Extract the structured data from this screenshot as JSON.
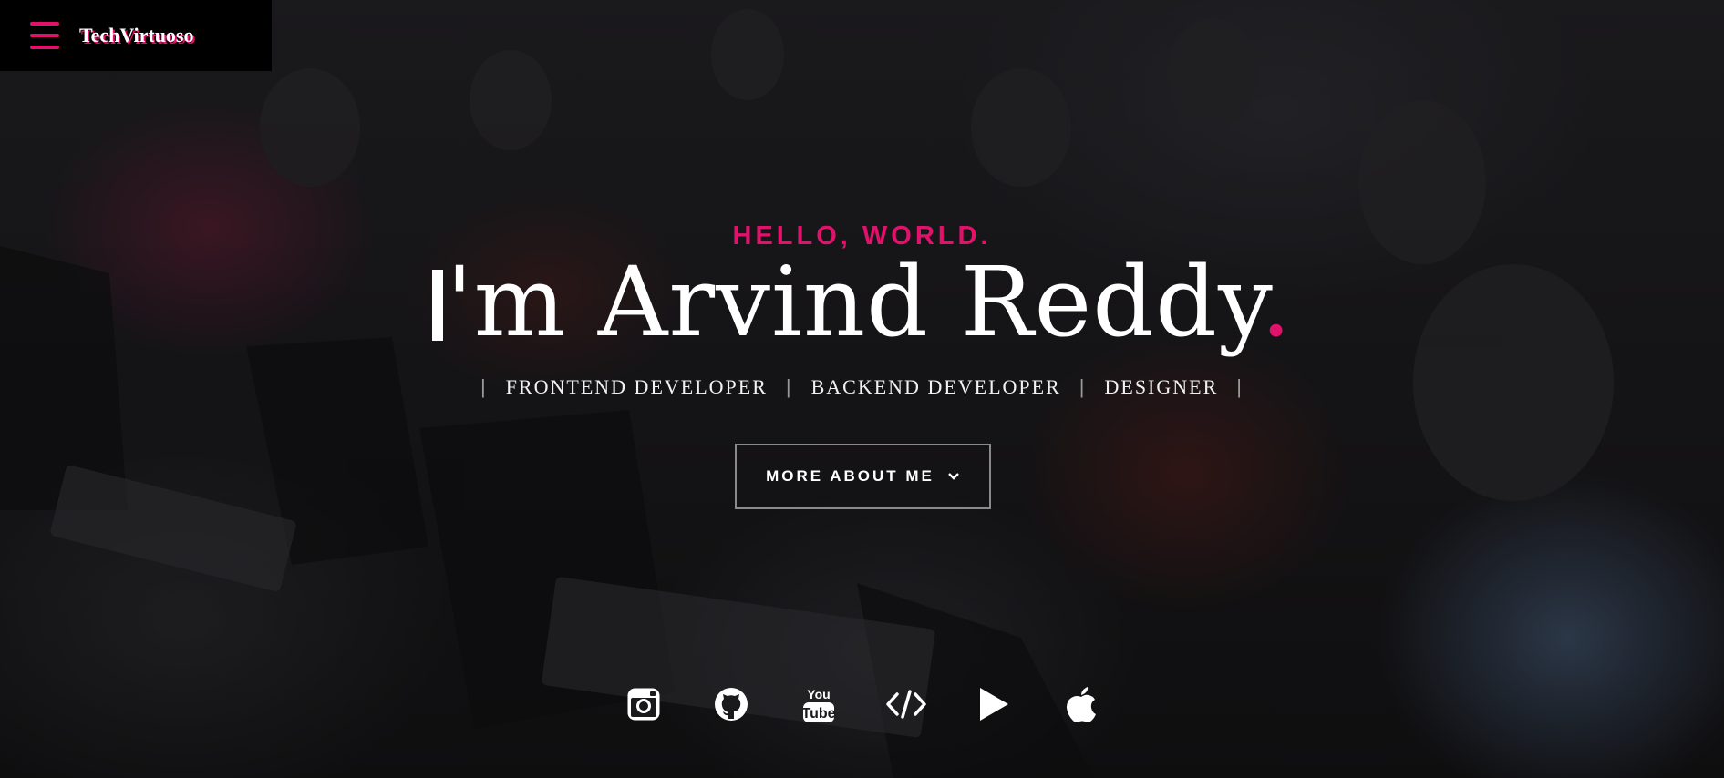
{
  "header": {
    "menu_icon": "hamburger-menu-icon",
    "brand": "TechVirtuoso"
  },
  "hero": {
    "greeting": "HELLO, WORLD.",
    "name_text": "'m Arvind Reddy",
    "name_period": ".",
    "roles": [
      "FRONTEND DEVELOPER",
      "BACKEND DEVELOPER",
      "DESIGNER"
    ],
    "separator": "|",
    "more_button": "MORE ABOUT ME",
    "more_icon": "chevron-down-icon"
  },
  "social": [
    {
      "icon": "instagram-icon"
    },
    {
      "icon": "github-icon"
    },
    {
      "icon": "youtube-icon"
    },
    {
      "icon": "code-icon"
    },
    {
      "icon": "play-store-icon"
    },
    {
      "icon": "apple-icon"
    }
  ],
  "colors": {
    "accent": "#e0126b",
    "text": "#ffffff",
    "header_bg": "#000000"
  }
}
